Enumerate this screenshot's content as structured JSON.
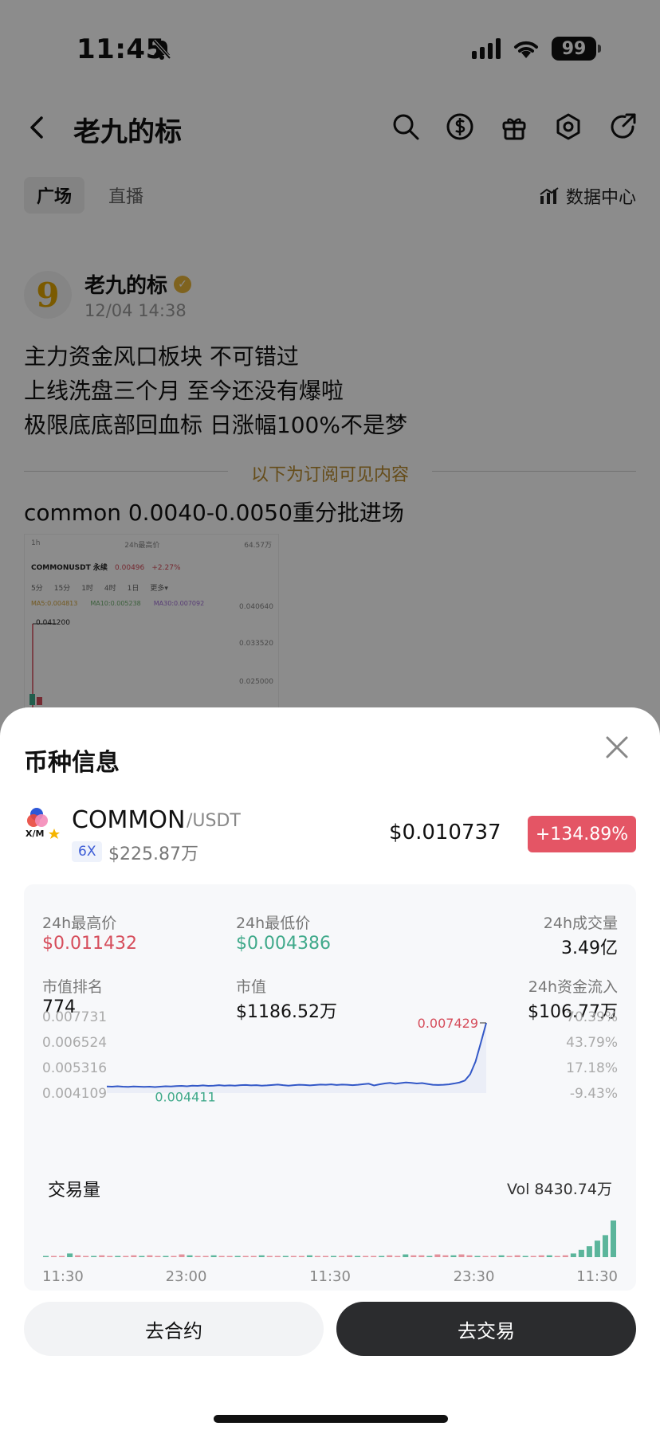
{
  "status": {
    "time": "11:45",
    "battery": "99"
  },
  "header": {
    "title": "老九的标"
  },
  "tabs": [
    "广场",
    "直播"
  ],
  "data_center_label": "数据中心",
  "post": {
    "author": "老九的标",
    "avatar_glyph": "9",
    "time": "12/04 14:38",
    "lines": [
      "主力资金风口板块 不可错过",
      "上线洗盘三个月 至今还没有爆啦",
      "极限底底部回血标 日涨幅100%不是梦"
    ],
    "subscribe_divider": "以下为订阅可见内容",
    "line_after": "common 0.0040-0.0050重分批进场"
  },
  "thumbnail": {
    "row1_left": "1h",
    "row1_mid": "24h最高价",
    "row1_right": "64.57万",
    "pair": "COMMONUSDT 永续",
    "price": "0.00496",
    "change": "+2.27%",
    "timeframes": [
      "5分",
      "15分",
      "1时",
      "4时",
      "1日",
      "更多▾"
    ],
    "ma": [
      "MA5:0.004813",
      "MA10:0.005238",
      "MA30:0.007092"
    ],
    "price_label": "0.041200",
    "axis": [
      "0.040640",
      "0.033520",
      "0.025000"
    ]
  },
  "sheet": {
    "title": "币种信息",
    "coin": "COMMON",
    "pair": "/USDT",
    "leverage": "6X",
    "market_cap_short": "$225.87万",
    "price": "$0.010737",
    "change": "+134.89%",
    "stats": {
      "high_label": "24h最高价",
      "high": "$0.011432",
      "low_label": "24h最低价",
      "low": "$0.004386",
      "volume_label": "24h成交量",
      "volume": "3.49亿",
      "rank_label": "市值排名",
      "rank": "774",
      "mcap_label": "市值",
      "mcap": "$1186.52万",
      "inflow_label": "24h资金流入",
      "inflow": "$106.77万"
    },
    "volume_title": "交易量",
    "volume_value": "Vol 8430.74万",
    "contract_button": "去合约",
    "trade_button": "去交易"
  },
  "colors": {
    "up": "#d64d5b",
    "down": "#3fa98a",
    "line": "#3358c7",
    "accent": "#e45565"
  },
  "chart_data": {
    "type": "line",
    "y_ticks": [
      "0.007731",
      "0.006524",
      "0.005316",
      "0.004109"
    ],
    "y_pct_ticks": [
      "70.39%",
      "43.79%",
      "17.18%",
      "-9.43%"
    ],
    "x_ticks": [
      "11:30",
      "23:00",
      "11:30",
      "23:30",
      "11:30"
    ],
    "ylim": [
      0.004109,
      0.007731
    ],
    "max_label": "0.007429",
    "min_label": "0.004411",
    "series": [
      {
        "values": [
          0.00442,
          0.00441,
          0.00443,
          0.00441,
          0.0044,
          0.00442,
          0.00441,
          0.0044,
          0.00441,
          0.00439,
          0.00441,
          0.00443,
          0.00442,
          0.00444,
          0.00445,
          0.00443,
          0.00446,
          0.00445,
          0.00447,
          0.00445,
          0.00446,
          0.00448,
          0.00446,
          0.00447,
          0.00446,
          0.00448,
          0.00449,
          0.00447,
          0.00448,
          0.00446,
          0.00447,
          0.00449,
          0.00451,
          0.00448,
          0.00446,
          0.00448,
          0.0045,
          0.00449,
          0.00447,
          0.00449,
          0.00451,
          0.0045,
          0.00452,
          0.00449,
          0.00451,
          0.0045,
          0.00448,
          0.0045,
          0.00453,
          0.00455,
          0.00447,
          0.00452,
          0.00456,
          0.00459,
          0.00455,
          0.00458,
          0.00461,
          0.00459,
          0.00456,
          0.00458,
          0.00454,
          0.0045,
          0.00449,
          0.0045,
          0.00452,
          0.00456,
          0.00461,
          0.0047,
          0.005,
          0.0056,
          0.0065,
          0.00743
        ]
      }
    ],
    "volume": [
      1,
      1,
      0.5,
      4,
      2,
      1,
      1,
      2,
      1,
      0.5,
      1,
      2,
      1,
      2,
      1,
      1,
      0.5,
      3,
      2,
      1,
      1,
      2,
      1,
      1,
      0.5,
      1,
      1,
      2,
      1,
      1,
      0.5,
      1,
      1,
      2,
      1,
      0.5,
      1,
      1,
      2,
      1,
      1,
      0.5,
      1,
      2,
      1,
      3,
      2,
      2,
      1,
      3,
      2,
      2,
      3,
      2,
      1,
      1,
      1,
      2,
      1,
      2,
      1,
      1,
      2,
      2,
      1,
      2,
      4,
      8,
      12,
      18,
      24,
      40
    ],
    "volume_colors": "down"
  }
}
